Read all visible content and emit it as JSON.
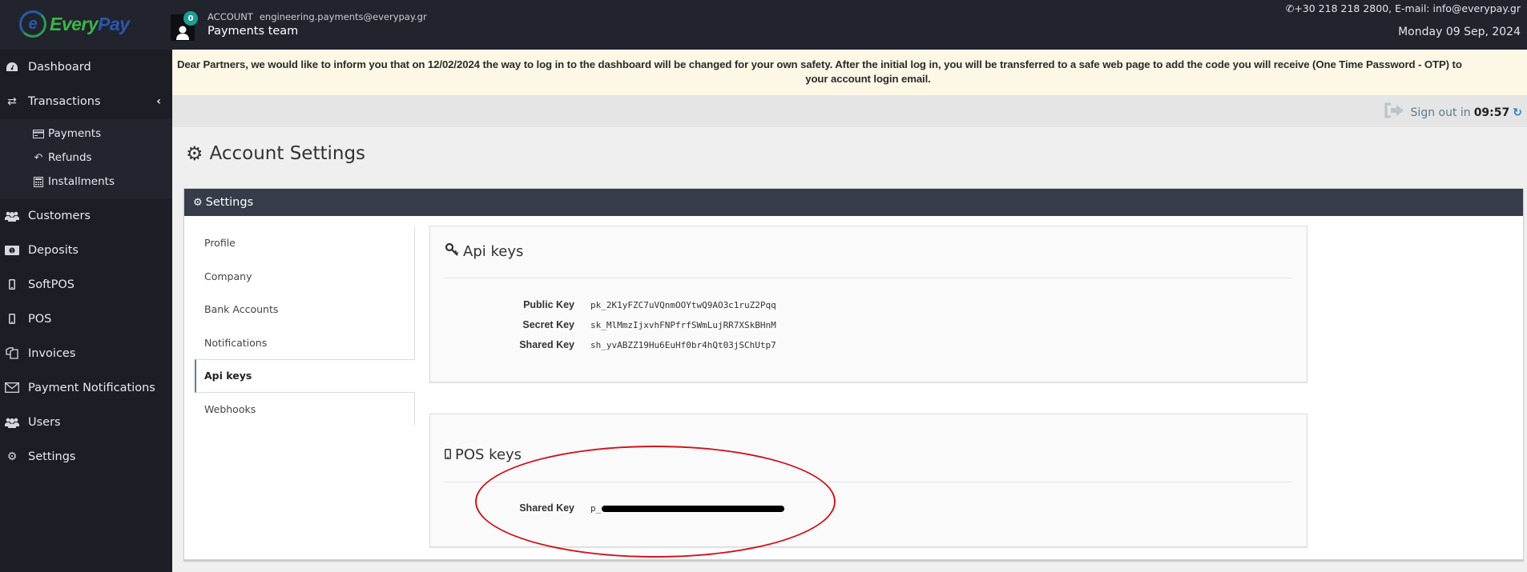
{
  "header": {
    "logo": {
      "part1": "Every",
      "part2": "Pay",
      "mark": "e"
    },
    "account": {
      "badge_count": "0",
      "label": "ACCOUNT",
      "email": "engineering.payments@everypay.gr",
      "name": "Payments team"
    },
    "contact": {
      "phone_icon": "phone-icon",
      "text": "+30 218 218 2800, E-mail: info@everypay.gr"
    },
    "date": "Monday 09 Sep, 2024"
  },
  "sidebar": {
    "items": [
      {
        "label": "Dashboard",
        "icon": "dashboard-icon"
      },
      {
        "label": "Transactions",
        "icon": "exchange-icon",
        "expanded": true,
        "children": [
          {
            "label": "Payments",
            "icon": "credit-card-icon"
          },
          {
            "label": "Refunds",
            "icon": "reply-icon"
          },
          {
            "label": "Installments",
            "icon": "calculator-icon"
          }
        ]
      },
      {
        "label": "Customers",
        "icon": "users-icon"
      },
      {
        "label": "Deposits",
        "icon": "money-icon"
      },
      {
        "label": "SoftPOS",
        "icon": "mobile-icon"
      },
      {
        "label": "POS",
        "icon": "mobile-icon"
      },
      {
        "label": "Invoices",
        "icon": "files-icon"
      },
      {
        "label": "Payment Notifications",
        "icon": "envelope-icon"
      },
      {
        "label": "Users",
        "icon": "users-icon"
      },
      {
        "label": "Settings",
        "icon": "gears-icon"
      }
    ]
  },
  "notice": {
    "line1": "Dear Partners, we would like to inform you that on 12/02/2024 the way to log in to the dashboard will be changed for your own safety. After the initial log in, you will be transferred to a safe web page to add the code you will receive (One Time Password - OTP) to",
    "line2": "your account login email."
  },
  "session": {
    "prefix": "Sign out in",
    "countdown": "09:57"
  },
  "page": {
    "title": "Account Settings"
  },
  "panel": {
    "heading": "Settings",
    "tabs": [
      {
        "label": "Profile",
        "active": false
      },
      {
        "label": "Company",
        "active": false
      },
      {
        "label": "Bank Accounts",
        "active": false
      },
      {
        "label": "Notifications",
        "active": false
      },
      {
        "label": "Api keys",
        "active": true
      },
      {
        "label": "Webhooks",
        "active": false
      }
    ],
    "api_keys": {
      "title": "Api keys",
      "rows": [
        {
          "label": "Public Key",
          "value": "pk_2K1yFZC7uVQnmOOYtwQ9AO3c1ruZ2Pqq"
        },
        {
          "label": "Secret Key",
          "value": "sk_MlMmzIjxvhFNPfrfSWmLujRR7XSkBHnM"
        },
        {
          "label": "Shared Key",
          "value": "sh_yvABZZ19Hu6EuHf0br4hQt03jSChUtp7"
        }
      ]
    },
    "pos_keys": {
      "title": "POS keys",
      "rows": [
        {
          "label": "Shared Key",
          "value_prefix": "p_",
          "redacted": true
        }
      ]
    }
  },
  "annotation": {
    "shape": "ellipse",
    "color": "#d0141c",
    "target": "pos-shared-key"
  },
  "colors": {
    "topbar": "#21242c",
    "sidebar": "#1c1e26",
    "panel_header": "#363c4a",
    "notice_bg": "#fdf7e6",
    "badge": "#1c9e93",
    "brand_green": "#3bb54a",
    "brand_blue": "#2a57b0"
  }
}
